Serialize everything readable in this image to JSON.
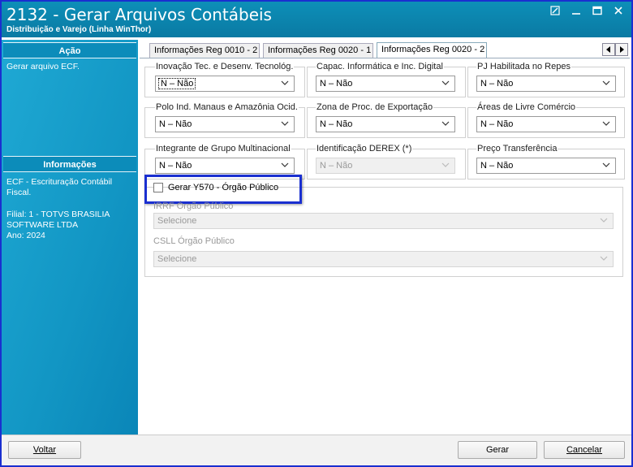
{
  "window": {
    "title": "2132 - Gerar Arquivos Contábeis",
    "subtitle": "Distribuição e Varejo (Linha WinThor)"
  },
  "sidebar": {
    "action_header": "Ação",
    "action_item": "Gerar arquivo ECF.",
    "info_header": "Informações",
    "info_line1": "ECF - Escrituração Contábil",
    "info_line2": "Fiscal.",
    "info_line3": "Filial: 1 - TOTVS BRASILIA",
    "info_line4": "SOFTWARE LTDA",
    "info_line5": "Ano: 2024"
  },
  "tabs": [
    {
      "label": "Informações Reg 0010 - 2",
      "active": false
    },
    {
      "label": "Informações Reg 0020 - 1",
      "active": false
    },
    {
      "label": "Informações Reg 0020 - 2",
      "active": true
    }
  ],
  "fields": {
    "inovacao": {
      "label": "Inovação Tec. e Desenv. Tecnológ.",
      "value": "N – Não"
    },
    "capac": {
      "label": "Capac. Informática e Inc. Digital",
      "value": "N – Não"
    },
    "pj_repes": {
      "label": "PJ Habilitada no Repes",
      "value": "N – Não"
    },
    "polo": {
      "label": "Polo Ind. Manaus e Amazônia Ocid.",
      "value": "N – Não"
    },
    "zona": {
      "label": "Zona de Proc. de Exportação",
      "value": "N – Não"
    },
    "areas": {
      "label": "Áreas de Livre Comércio",
      "value": "N – Não"
    },
    "integrante": {
      "label": "Integrante de Grupo Multinacional",
      "value": "N – Não"
    },
    "derex": {
      "label": "Identificação DEREX (*)",
      "value": "N – Não"
    },
    "preco": {
      "label": "Preço Transferência",
      "value": "N – Não"
    }
  },
  "y570": {
    "checkbox_label": "Gerar Y570 - Órgão Público",
    "checked": false,
    "irrf_label": "IRRF Órgão Público",
    "irrf_value": "Selecione",
    "csll_label": "CSLL Órgão Público",
    "csll_value": "Selecione"
  },
  "footer": {
    "voltar_label": "Voltar",
    "gerar_label": "Gerar",
    "cancelar_label": "Cancelar"
  },
  "colors": {
    "titlebar": "#0a7aa3",
    "sidebar": "#1296c4",
    "highlight_border": "#1a2fd0"
  },
  "icons": [
    "chevron-down-icon",
    "minimize-icon",
    "maximize-icon",
    "close-icon",
    "tab-prev-icon",
    "tab-next-icon"
  ]
}
